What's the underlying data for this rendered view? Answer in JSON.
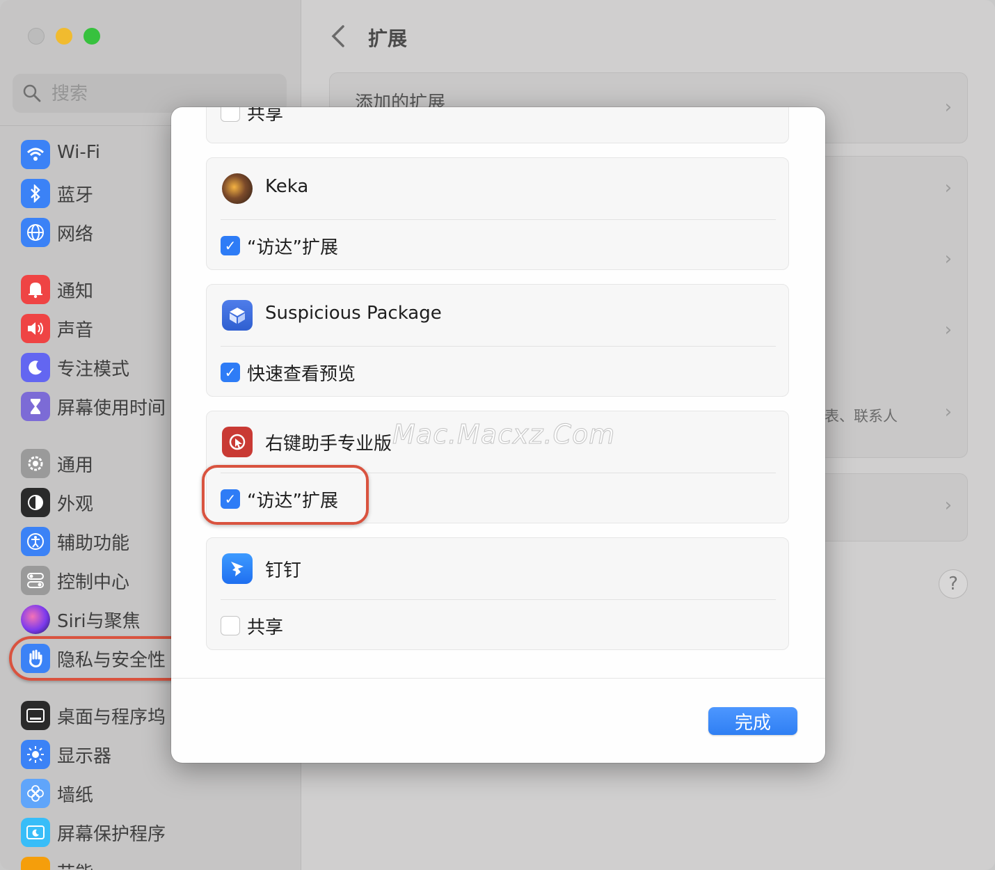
{
  "window": {
    "search_placeholder": "搜索"
  },
  "sidebar": {
    "items": [
      {
        "label": "Wi-Fi",
        "icon": "wifi-icon",
        "color": "#3b82f6"
      },
      {
        "label": "蓝牙",
        "icon": "bluetooth-icon",
        "color": "#3b82f6"
      },
      {
        "label": "网络",
        "icon": "globe-icon",
        "color": "#3b82f6"
      },
      {
        "label": "通知",
        "icon": "bell-icon",
        "color": "#ef4444"
      },
      {
        "label": "声音",
        "icon": "speaker-icon",
        "color": "#ef4444"
      },
      {
        "label": "专注模式",
        "icon": "moon-icon",
        "color": "#6366f1"
      },
      {
        "label": "屏幕使用时间",
        "icon": "hourglass-icon",
        "color": "#7c6bd6"
      },
      {
        "label": "通用",
        "icon": "gear-icon",
        "color": "#9a9a9a"
      },
      {
        "label": "外观",
        "icon": "appearance-icon",
        "color": "#2a2a2a"
      },
      {
        "label": "辅助功能",
        "icon": "accessibility-icon",
        "color": "#3b82f6"
      },
      {
        "label": "控制中心",
        "icon": "toggles-icon",
        "color": "#9a9a9a"
      },
      {
        "label": "Siri与聚焦",
        "icon": "siri-icon",
        "color": "#7c3aed"
      },
      {
        "label": "隐私与安全性",
        "icon": "hand-icon",
        "color": "#3b82f6"
      },
      {
        "label": "桌面与程序坞",
        "icon": "dock-icon",
        "color": "#2a2a2a"
      },
      {
        "label": "显示器",
        "icon": "sun-icon",
        "color": "#3b82f6"
      },
      {
        "label": "墙纸",
        "icon": "flower-icon",
        "color": "#60a5fa"
      },
      {
        "label": "屏幕保护程序",
        "icon": "screensaver-icon",
        "color": "#38bdf8"
      },
      {
        "label": "节能",
        "icon": "battery-icon",
        "color": "#f59e0b"
      }
    ]
  },
  "main": {
    "title": "扩展",
    "added_extensions": "添加的扩展",
    "snippet": "表、联系人",
    "help": "?"
  },
  "modal": {
    "top_partial_label": "共享",
    "groups": [
      {
        "app": "Keka",
        "icon": "keka-icon",
        "extension": "“访达”扩展",
        "checked": true
      },
      {
        "app": "Suspicious Package",
        "icon": "package-icon",
        "extension": "快速查看预览",
        "checked": true
      },
      {
        "app": "右键助手专业版",
        "icon": "right-click-icon",
        "extension": "“访达”扩展",
        "checked": true
      },
      {
        "app": "钉钉",
        "icon": "dingtalk-icon",
        "extension": "共享",
        "checked": false
      }
    ],
    "done_label": "完成"
  },
  "watermark": "Mac.Macxz.Com",
  "colors": {
    "accent": "#2e7cf6",
    "highlight": "#d9533f"
  }
}
